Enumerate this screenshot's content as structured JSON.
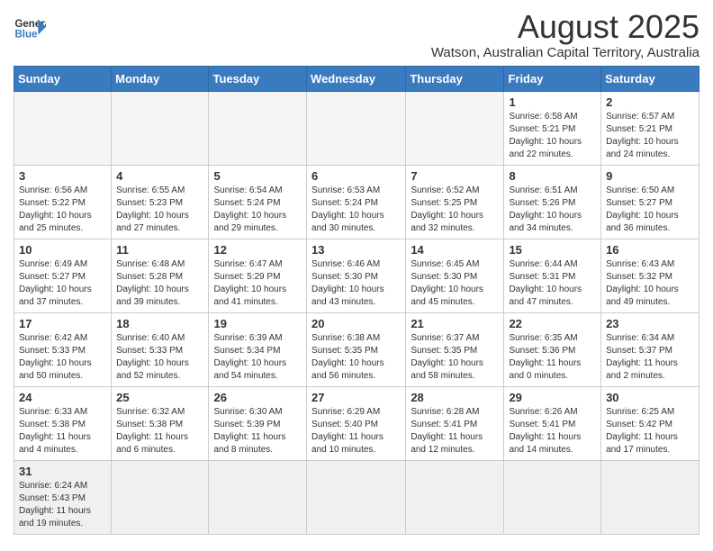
{
  "logo": {
    "line1": "General",
    "line2": "Blue"
  },
  "title": "August 2025",
  "subtitle": "Watson, Australian Capital Territory, Australia",
  "headers": [
    "Sunday",
    "Monday",
    "Tuesday",
    "Wednesday",
    "Thursday",
    "Friday",
    "Saturday"
  ],
  "weeks": [
    [
      {
        "day": "",
        "info": ""
      },
      {
        "day": "",
        "info": ""
      },
      {
        "day": "",
        "info": ""
      },
      {
        "day": "",
        "info": ""
      },
      {
        "day": "",
        "info": ""
      },
      {
        "day": "1",
        "info": "Sunrise: 6:58 AM\nSunset: 5:21 PM\nDaylight: 10 hours and 22 minutes."
      },
      {
        "day": "2",
        "info": "Sunrise: 6:57 AM\nSunset: 5:21 PM\nDaylight: 10 hours and 24 minutes."
      }
    ],
    [
      {
        "day": "3",
        "info": "Sunrise: 6:56 AM\nSunset: 5:22 PM\nDaylight: 10 hours and 25 minutes."
      },
      {
        "day": "4",
        "info": "Sunrise: 6:55 AM\nSunset: 5:23 PM\nDaylight: 10 hours and 27 minutes."
      },
      {
        "day": "5",
        "info": "Sunrise: 6:54 AM\nSunset: 5:24 PM\nDaylight: 10 hours and 29 minutes."
      },
      {
        "day": "6",
        "info": "Sunrise: 6:53 AM\nSunset: 5:24 PM\nDaylight: 10 hours and 30 minutes."
      },
      {
        "day": "7",
        "info": "Sunrise: 6:52 AM\nSunset: 5:25 PM\nDaylight: 10 hours and 32 minutes."
      },
      {
        "day": "8",
        "info": "Sunrise: 6:51 AM\nSunset: 5:26 PM\nDaylight: 10 hours and 34 minutes."
      },
      {
        "day": "9",
        "info": "Sunrise: 6:50 AM\nSunset: 5:27 PM\nDaylight: 10 hours and 36 minutes."
      }
    ],
    [
      {
        "day": "10",
        "info": "Sunrise: 6:49 AM\nSunset: 5:27 PM\nDaylight: 10 hours and 37 minutes."
      },
      {
        "day": "11",
        "info": "Sunrise: 6:48 AM\nSunset: 5:28 PM\nDaylight: 10 hours and 39 minutes."
      },
      {
        "day": "12",
        "info": "Sunrise: 6:47 AM\nSunset: 5:29 PM\nDaylight: 10 hours and 41 minutes."
      },
      {
        "day": "13",
        "info": "Sunrise: 6:46 AM\nSunset: 5:30 PM\nDaylight: 10 hours and 43 minutes."
      },
      {
        "day": "14",
        "info": "Sunrise: 6:45 AM\nSunset: 5:30 PM\nDaylight: 10 hours and 45 minutes."
      },
      {
        "day": "15",
        "info": "Sunrise: 6:44 AM\nSunset: 5:31 PM\nDaylight: 10 hours and 47 minutes."
      },
      {
        "day": "16",
        "info": "Sunrise: 6:43 AM\nSunset: 5:32 PM\nDaylight: 10 hours and 49 minutes."
      }
    ],
    [
      {
        "day": "17",
        "info": "Sunrise: 6:42 AM\nSunset: 5:33 PM\nDaylight: 10 hours and 50 minutes."
      },
      {
        "day": "18",
        "info": "Sunrise: 6:40 AM\nSunset: 5:33 PM\nDaylight: 10 hours and 52 minutes."
      },
      {
        "day": "19",
        "info": "Sunrise: 6:39 AM\nSunset: 5:34 PM\nDaylight: 10 hours and 54 minutes."
      },
      {
        "day": "20",
        "info": "Sunrise: 6:38 AM\nSunset: 5:35 PM\nDaylight: 10 hours and 56 minutes."
      },
      {
        "day": "21",
        "info": "Sunrise: 6:37 AM\nSunset: 5:35 PM\nDaylight: 10 hours and 58 minutes."
      },
      {
        "day": "22",
        "info": "Sunrise: 6:35 AM\nSunset: 5:36 PM\nDaylight: 11 hours and 0 minutes."
      },
      {
        "day": "23",
        "info": "Sunrise: 6:34 AM\nSunset: 5:37 PM\nDaylight: 11 hours and 2 minutes."
      }
    ],
    [
      {
        "day": "24",
        "info": "Sunrise: 6:33 AM\nSunset: 5:38 PM\nDaylight: 11 hours and 4 minutes."
      },
      {
        "day": "25",
        "info": "Sunrise: 6:32 AM\nSunset: 5:38 PM\nDaylight: 11 hours and 6 minutes."
      },
      {
        "day": "26",
        "info": "Sunrise: 6:30 AM\nSunset: 5:39 PM\nDaylight: 11 hours and 8 minutes."
      },
      {
        "day": "27",
        "info": "Sunrise: 6:29 AM\nSunset: 5:40 PM\nDaylight: 11 hours and 10 minutes."
      },
      {
        "day": "28",
        "info": "Sunrise: 6:28 AM\nSunset: 5:41 PM\nDaylight: 11 hours and 12 minutes."
      },
      {
        "day": "29",
        "info": "Sunrise: 6:26 AM\nSunset: 5:41 PM\nDaylight: 11 hours and 14 minutes."
      },
      {
        "day": "30",
        "info": "Sunrise: 6:25 AM\nSunset: 5:42 PM\nDaylight: 11 hours and 17 minutes."
      }
    ],
    [
      {
        "day": "31",
        "info": "Sunrise: 6:24 AM\nSunset: 5:43 PM\nDaylight: 11 hours and 19 minutes."
      },
      {
        "day": "",
        "info": ""
      },
      {
        "day": "",
        "info": ""
      },
      {
        "day": "",
        "info": ""
      },
      {
        "day": "",
        "info": ""
      },
      {
        "day": "",
        "info": ""
      },
      {
        "day": "",
        "info": ""
      }
    ]
  ]
}
